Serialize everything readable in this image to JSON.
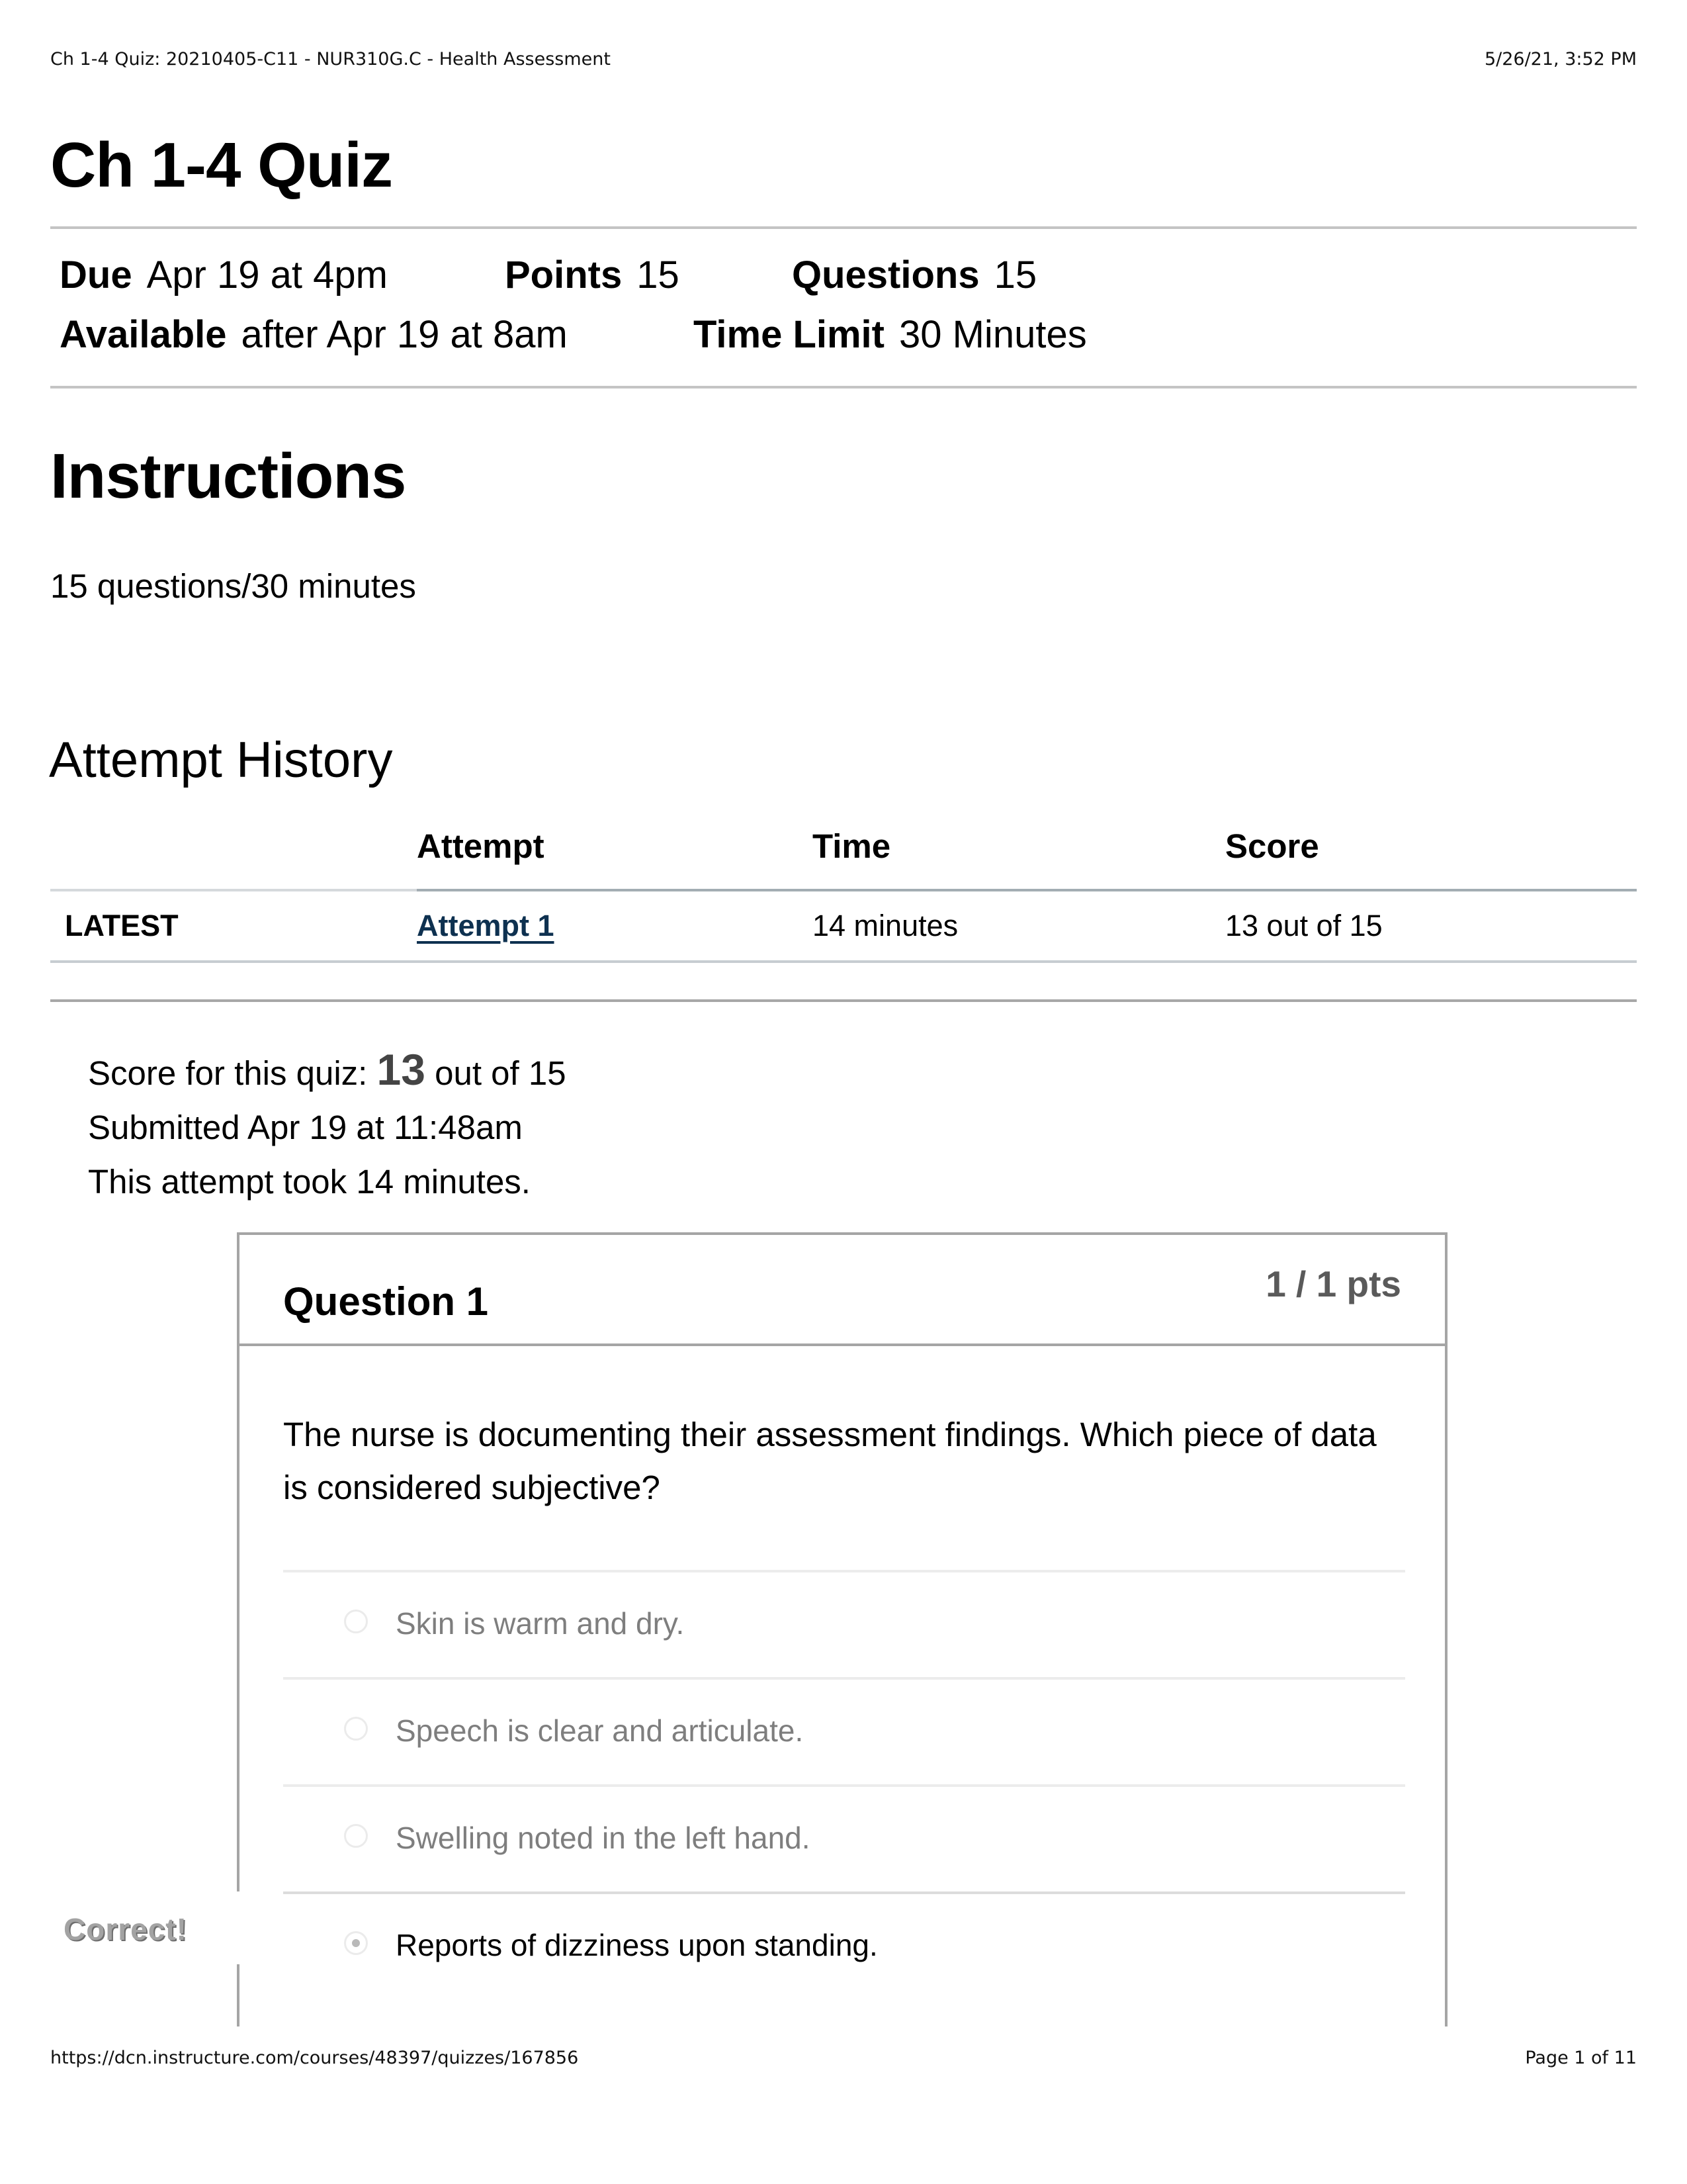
{
  "print_header": {
    "title": "Ch 1-4 Quiz: 20210405-C11 - NUR310G.C - Health Assessment",
    "datetime": "5/26/21, 3:52 PM"
  },
  "page_title": "Ch 1-4 Quiz",
  "details": {
    "due_label": "Due",
    "due_value": "Apr 19 at 4pm",
    "points_label": "Points",
    "points_value": "15",
    "questions_label": "Questions",
    "questions_value": "15",
    "available_label": "Available",
    "available_value": "after Apr 19 at 8am",
    "time_limit_label": "Time Limit",
    "time_limit_value": "30 Minutes"
  },
  "instructions": {
    "title": "Instructions",
    "text": "15 questions/30 minutes"
  },
  "attempt_history": {
    "title": "Attempt History",
    "columns": [
      "",
      "Attempt",
      "Time",
      "Score"
    ],
    "rows": [
      {
        "tag": "LATEST",
        "attempt": "Attempt 1",
        "time": "14 minutes",
        "score": "13 out of 15"
      }
    ]
  },
  "summary": {
    "score_prefix": "Score for this quiz:",
    "score_value": "13",
    "score_suffix": "out of 15",
    "submitted": "Submitted Apr 19 at 11:48am",
    "duration": "This attempt took 14 minutes."
  },
  "question": {
    "title": "Question 1",
    "points": "1 / 1 pts",
    "text": "The nurse is documenting their assessment findings. Which piece of data is considered subjective?",
    "answers": [
      {
        "text": "Skin is warm and dry.",
        "selected": false
      },
      {
        "text": "Speech is clear and articulate.",
        "selected": false
      },
      {
        "text": "Swelling noted in the left hand.",
        "selected": false
      },
      {
        "text": "Reports of dizziness upon standing.",
        "selected": true
      }
    ],
    "result_label": "Correct!"
  },
  "print_footer": {
    "url": "https://dcn.instructure.com/courses/48397/quizzes/167856",
    "page": "Page 1 of 11"
  }
}
